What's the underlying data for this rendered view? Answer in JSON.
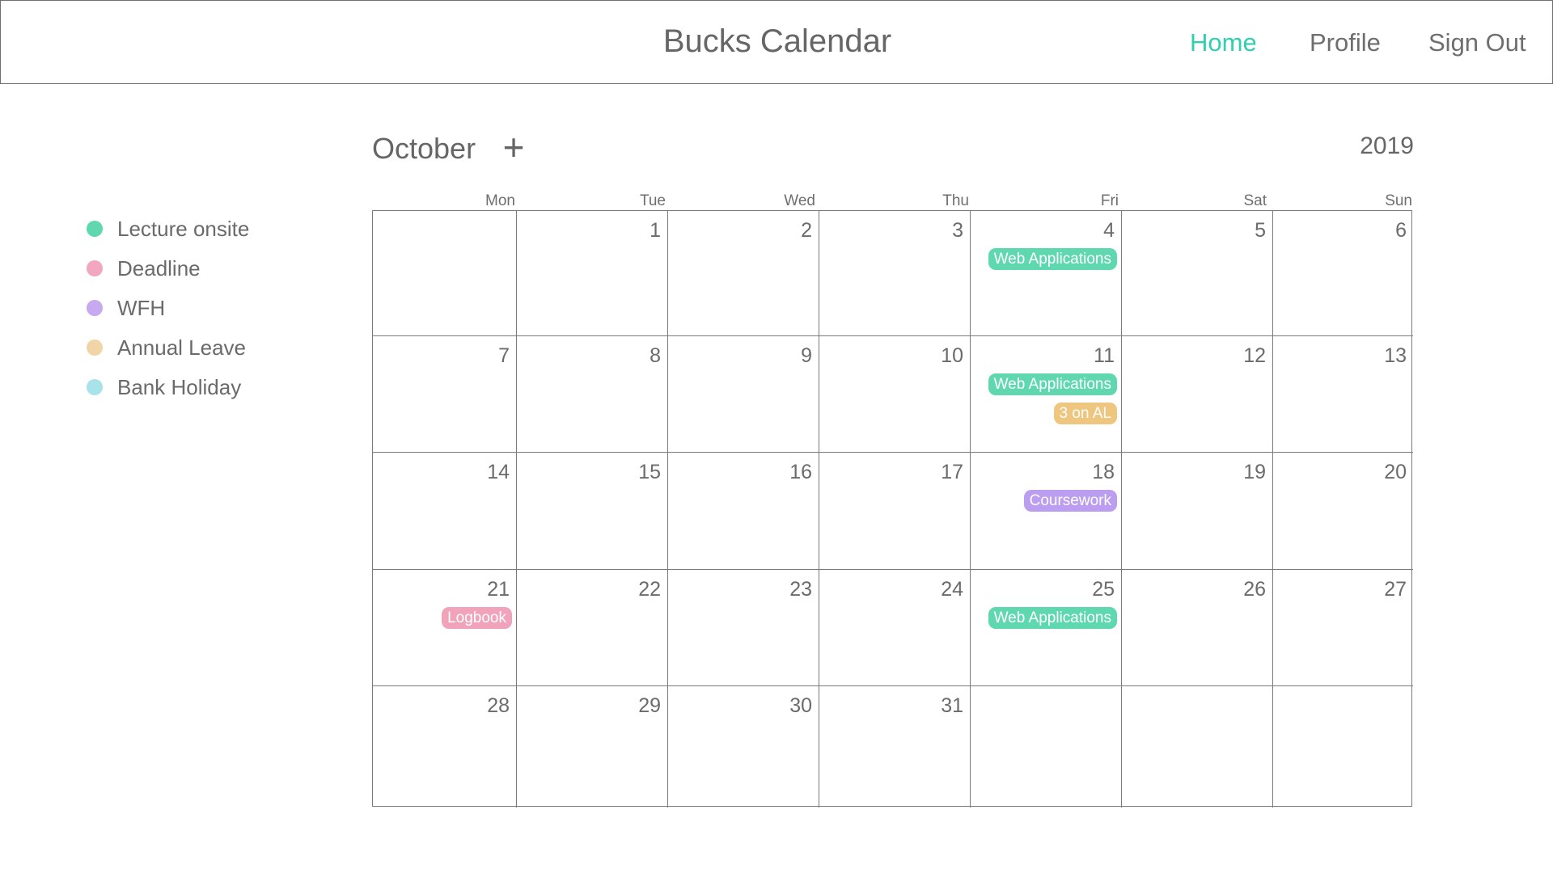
{
  "header": {
    "title": "Bucks Calendar",
    "nav": [
      {
        "label": "Home",
        "active": true
      },
      {
        "label": "Profile",
        "active": false
      },
      {
        "label": "Sign Out",
        "active": false
      }
    ]
  },
  "legend": [
    {
      "label": "Lecture onsite",
      "color": "#5fd8b0"
    },
    {
      "label": "Deadline",
      "color": "#f2a7bf"
    },
    {
      "label": "WFH",
      "color": "#c6a9ef"
    },
    {
      "label": "Annual Leave",
      "color": "#f1d5a6"
    },
    {
      "label": "Bank Holiday",
      "color": "#a8e3ea"
    }
  ],
  "calendar": {
    "month": "October",
    "add_label": "+",
    "year": "2019",
    "weekdays": [
      "Mon",
      "Tue",
      "Wed",
      "Thu",
      "Fri",
      "Sat",
      "Sun"
    ],
    "weeks": [
      [
        "",
        "1",
        "2",
        "3",
        "4",
        "5",
        "6"
      ],
      [
        "7",
        "8",
        "9",
        "10",
        "11",
        "12",
        "13"
      ],
      [
        "14",
        "15",
        "16",
        "17",
        "18",
        "19",
        "20"
      ],
      [
        "21",
        "22",
        "23",
        "24",
        "25",
        "26",
        "27"
      ],
      [
        "28",
        "29",
        "30",
        "31",
        "",
        "",
        ""
      ]
    ],
    "events": [
      {
        "day": "4",
        "label": "Web Applications",
        "color": "#5fd8b0"
      },
      {
        "day": "11",
        "label": "Web Applications",
        "color": "#5fd8b0"
      },
      {
        "day": "11",
        "label": "3 on AL",
        "color": "#efc67f"
      },
      {
        "day": "18",
        "label": "Coursework",
        "color": "#bc9ef0"
      },
      {
        "day": "21",
        "label": "Logbook",
        "color": "#f0a3bb"
      },
      {
        "day": "25",
        "label": "Web Applications",
        "color": "#5fd8b0"
      }
    ]
  }
}
